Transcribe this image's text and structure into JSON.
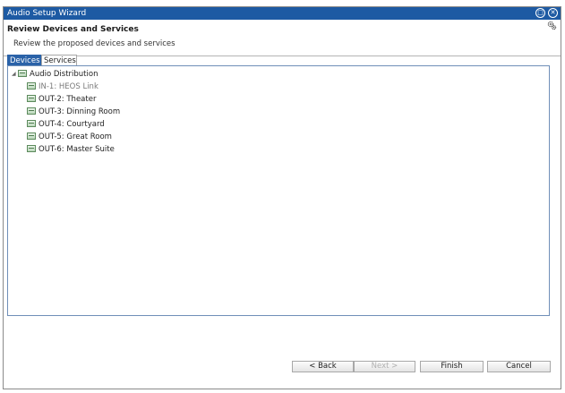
{
  "window": {
    "title": "Audio Setup Wizard",
    "accent_color": "#1d5aa3"
  },
  "titlebar_buttons": {
    "restore_icon": "restore-icon",
    "close_icon": "close-icon"
  },
  "header": {
    "title": "Review Devices and Services",
    "subtitle": "Review the proposed devices and services",
    "icon": "settings-gear-icon"
  },
  "tabs": [
    {
      "label": "Devices",
      "selected": true
    },
    {
      "label": "Services",
      "selected": false
    }
  ],
  "tree": {
    "root": {
      "label": "Audio Distribution",
      "expanded": true,
      "icon": "device-icon"
    },
    "children": [
      {
        "label": "IN-1: HEOS Link",
        "dim": true,
        "icon": "device-icon"
      },
      {
        "label": "OUT-2: Theater",
        "dim": false,
        "icon": "device-icon"
      },
      {
        "label": "OUT-3: Dinning Room",
        "dim": false,
        "icon": "device-icon"
      },
      {
        "label": "OUT-4: Courtyard",
        "dim": false,
        "icon": "device-icon"
      },
      {
        "label": "OUT-5: Great Room",
        "dim": false,
        "icon": "device-icon"
      },
      {
        "label": "OUT-6: Master Suite",
        "dim": false,
        "icon": "device-icon"
      }
    ]
  },
  "footer": {
    "back_label": "< Back",
    "next_label": "Next >",
    "finish_label": "Finish",
    "cancel_label": "Cancel",
    "next_enabled": false
  }
}
